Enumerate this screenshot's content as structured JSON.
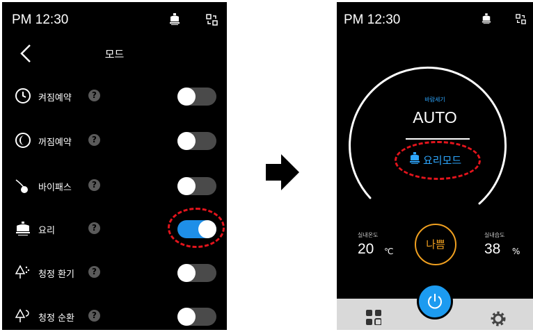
{
  "left_screen": {
    "time": "PM 12:30",
    "title": "모드",
    "rows": [
      {
        "label": "켜짐예약",
        "help": "?",
        "on": false,
        "icon": "clock-icon"
      },
      {
        "label": "꺼짐예약",
        "help": "?",
        "on": false,
        "icon": "moon-icon"
      },
      {
        "label": "바이패스",
        "help": "?",
        "on": false,
        "icon": "bypass-icon"
      },
      {
        "label": "요리",
        "help": "?",
        "on": true,
        "icon": "cooking-pot-icon"
      },
      {
        "label": "청정 환기",
        "help": "?",
        "on": false,
        "icon": "tree-ventilation-icon"
      },
      {
        "label": "청정 순환",
        "help": "?",
        "on": false,
        "icon": "tree-circulation-icon"
      }
    ]
  },
  "right_screen": {
    "time": "PM 12:30",
    "wind_label": "바람세기",
    "wind_value": "AUTO",
    "cook_mode": "요리모드",
    "indoor_temp_label": "실내온도",
    "indoor_temp_value": "20",
    "indoor_temp_unit": "℃",
    "air_quality": "나쁨",
    "indoor_humidity_label": "실내습도",
    "indoor_humidity_value": "38",
    "indoor_humidity_unit": "%"
  },
  "colors": {
    "accent": "#1e8fe8",
    "highlight": "#e3141c",
    "air_quality": "#f0a020"
  }
}
